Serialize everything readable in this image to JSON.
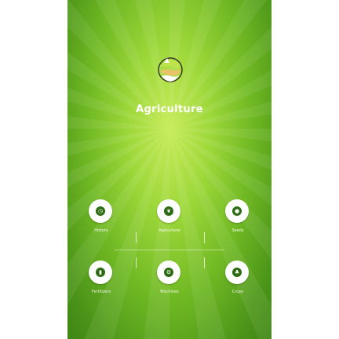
{
  "app": {
    "title": "Agriculture"
  },
  "menu": {
    "row1": [
      {
        "label": "History",
        "icon": "history-icon"
      },
      {
        "label": "Agriculture",
        "icon": "leaf-icon"
      },
      {
        "label": "Seeds",
        "icon": "seed-icon"
      }
    ],
    "row2": [
      {
        "label": "Fertilizers",
        "icon": "fertilizer-icon"
      },
      {
        "label": "Machines",
        "icon": "tractor-icon"
      },
      {
        "label": "Crops",
        "icon": "sprout-icon"
      }
    ]
  },
  "colors": {
    "background": "#7cc42a",
    "icon_bg": "#ffffff",
    "icon_fg": "#2d6b12",
    "text": "#ffffff"
  }
}
